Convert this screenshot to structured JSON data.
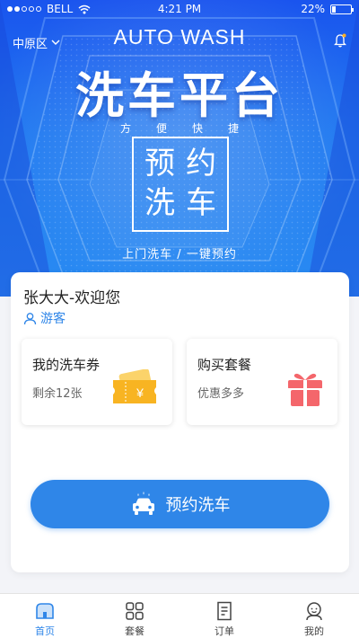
{
  "status_bar": {
    "carrier": "BELL",
    "time": "4:21 PM",
    "battery": "22%",
    "battery_level": 0.22
  },
  "header": {
    "location": "中原区"
  },
  "hero": {
    "auto_wash": "AUTO WASH",
    "title": "洗车平台",
    "slogan": "方便快捷",
    "box_line1": "预约",
    "box_line2": "洗车",
    "service_line": "上门洗车 /  一键预约"
  },
  "user": {
    "greeting": "张大大-欢迎您",
    "role": "游客"
  },
  "cards": {
    "coupon": {
      "title": "我的洗车券",
      "subtitle": "剩余12张",
      "icon": "coupon-ticket-icon"
    },
    "package": {
      "title": "购买套餐",
      "subtitle": "优惠多多",
      "icon": "gift-box-icon"
    }
  },
  "book_button": {
    "label": "预约洗车",
    "icon": "car-wash-icon"
  },
  "tabs": [
    {
      "label": "首页",
      "icon": "home-icon",
      "active": true
    },
    {
      "label": "套餐",
      "icon": "grid-icon",
      "active": false
    },
    {
      "label": "订单",
      "icon": "order-document-icon",
      "active": false
    },
    {
      "label": "我的",
      "icon": "profile-icon",
      "active": false
    }
  ],
  "colors": {
    "primary": "#2f86e8",
    "hero_top": "#1a54ee",
    "coupon": "#f8b422",
    "gift": "#f4666b"
  }
}
